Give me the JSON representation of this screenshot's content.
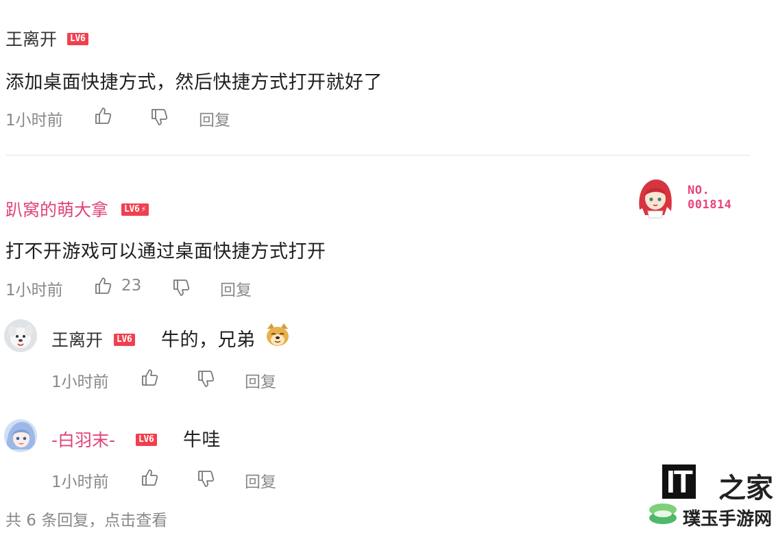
{
  "comments": [
    {
      "username": "王离开",
      "level": "LV6",
      "content": "添加桌面快捷方式，然后快捷方式打开就好了",
      "time": "1小时前",
      "reply_label": "回复"
    },
    {
      "username": "趴窝的萌大拿",
      "level": "LV6",
      "level_extra": "⚡",
      "content": "打不开游戏可以通过桌面快捷方式打开",
      "time": "1小时前",
      "likes": "23",
      "reply_label": "回复",
      "badge_label": "NO.",
      "badge_number": "001814"
    }
  ],
  "replies": [
    {
      "username": "王离开",
      "level": "LV6",
      "content": "牛的，兄弟",
      "emoji": "doge-emoji",
      "time": "1小时前",
      "reply_label": "回复"
    },
    {
      "username": "-白羽末-",
      "level": "LV6",
      "content": "牛哇",
      "time": "1小时前",
      "reply_label": "回复"
    }
  ],
  "footer": {
    "view_replies": "共 6 条回复，点击查看"
  },
  "watermark": {
    "logo": "IT",
    "logo_script": "之家",
    "site_name": "璞玉手游网"
  },
  "colors": {
    "pink_username": "#e0437a",
    "level_badge": "#f0404f",
    "meta_gray": "#888888"
  }
}
